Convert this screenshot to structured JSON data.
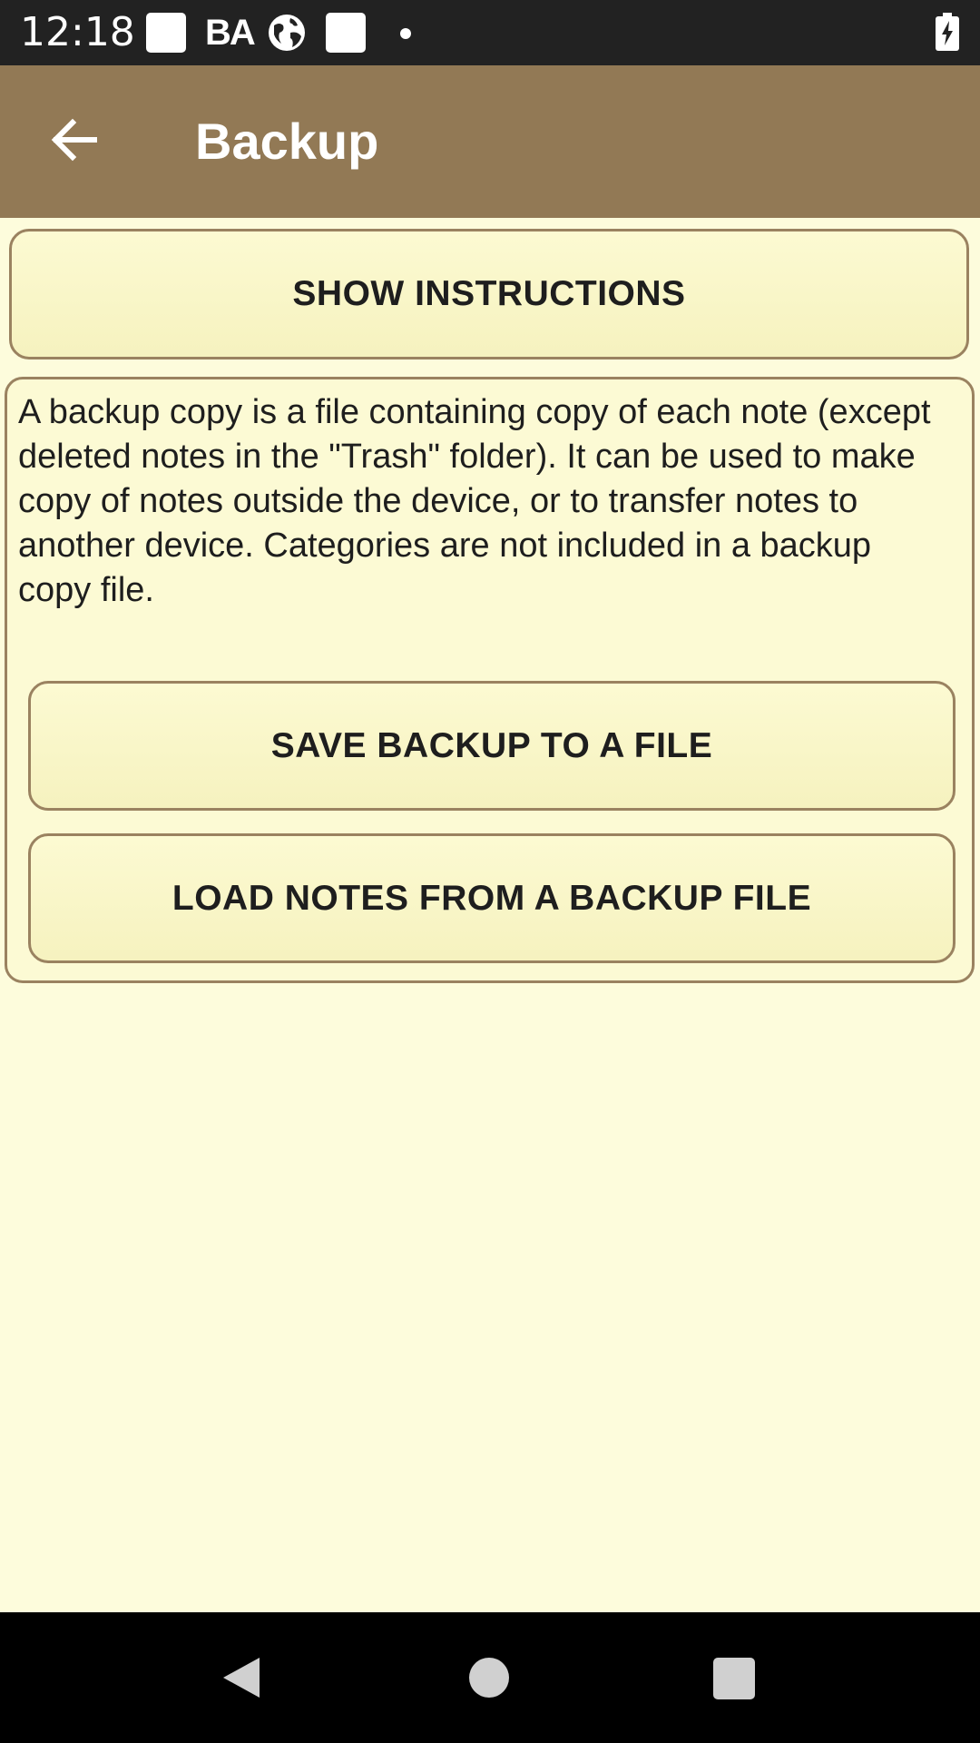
{
  "status_bar": {
    "time": "12:18",
    "notification_text": "BA",
    "icons": [
      "white-square-icon",
      "globe-icon",
      "white-square-icon",
      "dot-icon",
      "battery-charging-icon"
    ]
  },
  "app_bar": {
    "title": "Backup",
    "back_icon": "arrow-left-icon",
    "background_color": "#927955"
  },
  "buttons": {
    "show_instructions": "SHOW INSTRUCTIONS",
    "save_backup": "SAVE BACKUP TO A FILE",
    "load_notes": "LOAD NOTES FROM A BACKUP FILE"
  },
  "description": "A backup copy is a file containing copy of each note (except deleted notes in the \"Trash\" folder). It can be used to make copy of notes outside the device, or to transfer notes to another device. Categories are not included in a backup copy file.",
  "nav_bar": {
    "icons": [
      "nav-back-icon",
      "nav-home-icon",
      "nav-recents-icon"
    ]
  },
  "colors": {
    "page_background": "#fdfcdc",
    "button_border": "#9a8260",
    "status_bar": "#222222"
  }
}
